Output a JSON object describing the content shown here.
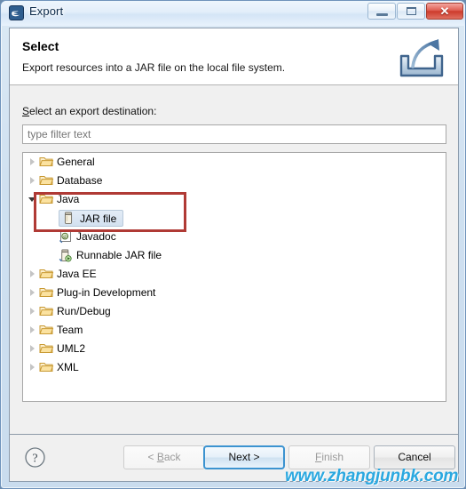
{
  "window": {
    "title": "Export",
    "title_icon": "eclipse-icon",
    "controls": {
      "minimize": "minimize-icon",
      "maximize": "maximize-icon",
      "close_label": "✕"
    }
  },
  "header": {
    "title": "Select",
    "description": "Export resources into a JAR file on the local file system.",
    "icon": "export-wizard-icon"
  },
  "body": {
    "destination_label_prefix": "S",
    "destination_label_rest": "elect an export destination:",
    "filter": {
      "placeholder": "type filter text",
      "value": ""
    },
    "tree": [
      {
        "label": "General",
        "level": 1,
        "state": "collapsed",
        "icon": "folder-icon",
        "selected": false
      },
      {
        "label": "Database",
        "level": 1,
        "state": "collapsed",
        "icon": "folder-icon",
        "selected": false
      },
      {
        "label": "Java",
        "level": 1,
        "state": "expanded",
        "icon": "folder-icon",
        "selected": false
      },
      {
        "label": "JAR file",
        "level": 2,
        "state": "leaf",
        "icon": "jar-file-icon",
        "selected": true
      },
      {
        "label": "Javadoc",
        "level": 2,
        "state": "leaf",
        "icon": "javadoc-icon",
        "selected": false
      },
      {
        "label": "Runnable JAR file",
        "level": 2,
        "state": "leaf",
        "icon": "runnable-jar-file-icon",
        "selected": false
      },
      {
        "label": "Java EE",
        "level": 1,
        "state": "collapsed",
        "icon": "folder-icon",
        "selected": false
      },
      {
        "label": "Plug-in Development",
        "level": 1,
        "state": "collapsed",
        "icon": "folder-icon",
        "selected": false
      },
      {
        "label": "Run/Debug",
        "level": 1,
        "state": "collapsed",
        "icon": "folder-icon",
        "selected": false
      },
      {
        "label": "Team",
        "level": 1,
        "state": "collapsed",
        "icon": "folder-icon",
        "selected": false
      },
      {
        "label": "UML2",
        "level": 1,
        "state": "collapsed",
        "icon": "folder-icon",
        "selected": false
      },
      {
        "label": "XML",
        "level": 1,
        "state": "collapsed",
        "icon": "folder-icon",
        "selected": false
      }
    ],
    "annotation_box_color": "#b03a35"
  },
  "footer": {
    "help_icon": "help-question-icon",
    "back": {
      "label_prefix": "< ",
      "mnemonic": "B",
      "label_rest": "ack",
      "enabled": false
    },
    "next": {
      "label": "Next >",
      "enabled": true,
      "default": true
    },
    "finish": {
      "label_prefix": "",
      "mnemonic": "F",
      "label_rest": "inish",
      "enabled": false
    },
    "cancel": {
      "label": "Cancel",
      "enabled": true
    }
  },
  "watermark": {
    "text": "www.zhangjunbk.com",
    "color": "#2aa8e0"
  }
}
